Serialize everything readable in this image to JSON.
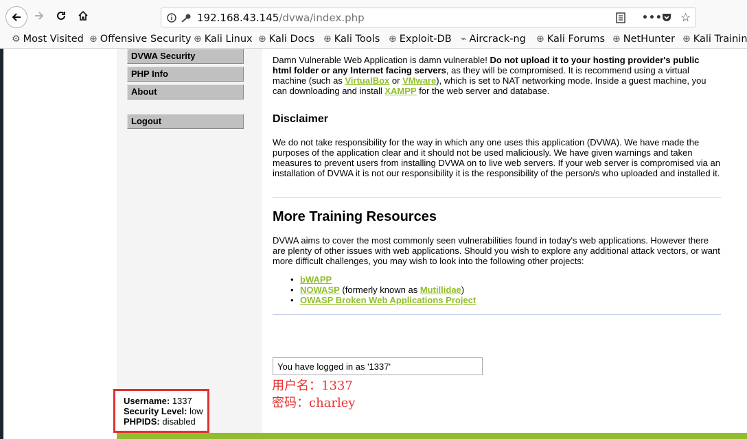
{
  "browser": {
    "url_host": "192.168.43.145",
    "url_path": "/dvwa/index.php",
    "bookmarks": [
      "Most Visited",
      "Offensive Security",
      "Kali Linux",
      "Kali Docs",
      "Kali Tools",
      "Exploit-DB",
      "Aircrack-ng",
      "Kali Forums",
      "NetHunter",
      "Kali Trainin"
    ]
  },
  "menu": {
    "items": [
      "DVWA Security",
      "PHP Info",
      "About"
    ],
    "logout": "Logout"
  },
  "intro": {
    "text1": "Damn Vulnerable Web Application is damn vulnerable! ",
    "bold": "Do not upload it to your hosting provider's public html folder or any Internet facing servers",
    "text2": ", as they will be compromised. It is recommend using a virtual machine (such as ",
    "link_virtualbox": "VirtualBox",
    "or": " or ",
    "link_vmware": "VMware",
    "text3": "), which is set to NAT networking mode. Inside a guest machine, you can downloading and install ",
    "link_xampp": "XAMPP",
    "text4": " for the web server and database."
  },
  "disclaimer": {
    "heading": "Disclaimer",
    "body": "We do not take responsibility for the way in which any one uses this application (DVWA). We have made the purposes of the application clear and it should not be used maliciously. We have given warnings and taken measures to prevent users from installing DVWA on to live web servers. If your web server is compromised via an installation of DVWA it is not our responsibility it is the responsibility of the person/s who uploaded and installed it."
  },
  "training": {
    "heading": "More Training Resources",
    "body": "DVWA aims to cover the most commonly seen vulnerabilities found in today's web applications. However there are plenty of other issues with web applications. Should you wish to explore any additional attack vectors, or want more difficult challenges, you may wish to look into the following other projects:",
    "link_bwapp": "bWAPP",
    "link_nowasp": "NOWASP",
    "formerly": " (formerly known as ",
    "link_mutillidae": "Mutillidae",
    "close_paren": ")",
    "link_owasp": "OWASP Broken Web Applications Project"
  },
  "login_message": "You have logged in as '1337'",
  "annotation": {
    "line1": "用户名：1337",
    "line2": "密码：charley"
  },
  "info": {
    "username_label": "Username:",
    "username_value": " 1337",
    "security_label": "Security Level:",
    "security_value": " low",
    "phpids_label": "PHPIDS:",
    "phpids_value": " disabled"
  },
  "colors": {
    "link_green": "#8fbe2a",
    "annotation_red": "#e8312d"
  }
}
